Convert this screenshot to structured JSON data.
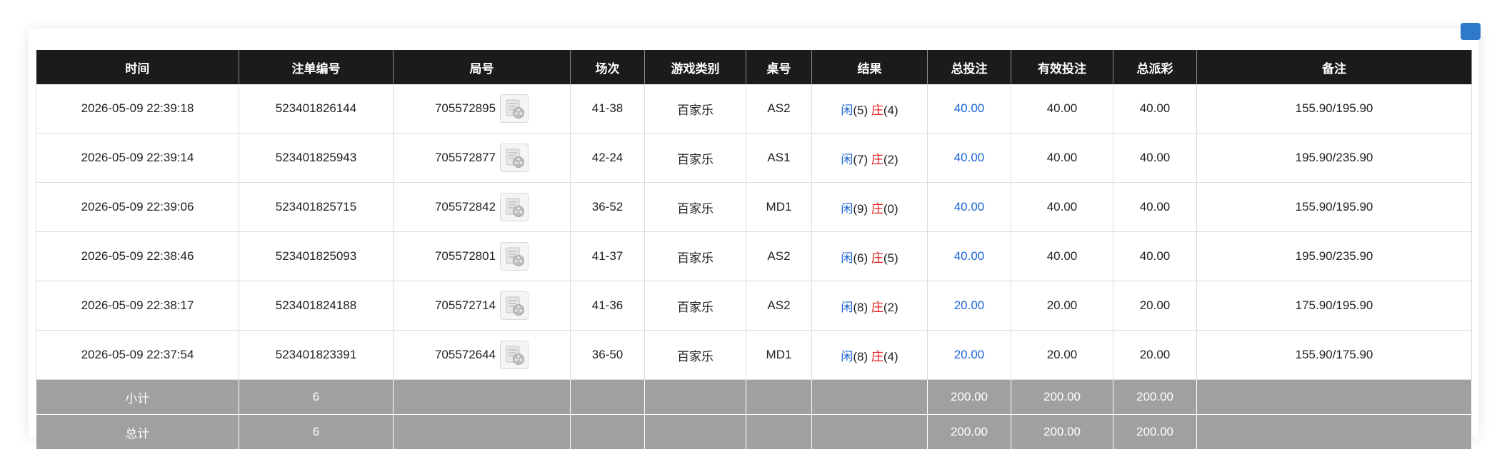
{
  "colors": {
    "header_bg": "#1b1b1b",
    "summary_bg": "#a0a0a0",
    "player_blue": "#1a64d6",
    "banker_red": "#e01b1b",
    "corner_button": "#2f79c9"
  },
  "table": {
    "headers": [
      "时间",
      "注单编号",
      "局号",
      "场次",
      "游戏类别",
      "桌号",
      "结果",
      "总投注",
      "有效投注",
      "总派彩",
      "备注"
    ],
    "rows": [
      {
        "time": "2026-05-09 22:39:18",
        "order": "523401826144",
        "round": "705572895",
        "session": "41-38",
        "game": "百家乐",
        "table": "AS2",
        "player": "闲",
        "player_score": "(5)",
        "banker": "庄",
        "banker_score": "(4)",
        "total_bet": "40.00",
        "valid_bet": "40.00",
        "payout": "40.00",
        "remark": "155.90/195.90"
      },
      {
        "time": "2026-05-09 22:39:14",
        "order": "523401825943",
        "round": "705572877",
        "session": "42-24",
        "game": "百家乐",
        "table": "AS1",
        "player": "闲",
        "player_score": "(7)",
        "banker": "庄",
        "banker_score": "(2)",
        "total_bet": "40.00",
        "valid_bet": "40.00",
        "payout": "40.00",
        "remark": "195.90/235.90"
      },
      {
        "time": "2026-05-09 22:39:06",
        "order": "523401825715",
        "round": "705572842",
        "session": "36-52",
        "game": "百家乐",
        "table": "MD1",
        "player": "闲",
        "player_score": "(9)",
        "banker": "庄",
        "banker_score": "(0)",
        "total_bet": "40.00",
        "valid_bet": "40.00",
        "payout": "40.00",
        "remark": "155.90/195.90"
      },
      {
        "time": "2026-05-09 22:38:46",
        "order": "523401825093",
        "round": "705572801",
        "session": "41-37",
        "game": "百家乐",
        "table": "AS2",
        "player": "闲",
        "player_score": "(6)",
        "banker": "庄",
        "banker_score": "(5)",
        "total_bet": "40.00",
        "valid_bet": "40.00",
        "payout": "40.00",
        "remark": "195.90/235.90"
      },
      {
        "time": "2026-05-09 22:38:17",
        "order": "523401824188",
        "round": "705572714",
        "session": "41-36",
        "game": "百家乐",
        "table": "AS2",
        "player": "闲",
        "player_score": "(8)",
        "banker": "庄",
        "banker_score": "(2)",
        "total_bet": "20.00",
        "valid_bet": "20.00",
        "payout": "20.00",
        "remark": "175.90/195.90"
      },
      {
        "time": "2026-05-09 22:37:54",
        "order": "523401823391",
        "round": "705572644",
        "session": "36-50",
        "game": "百家乐",
        "table": "MD1",
        "player": "闲",
        "player_score": "(8)",
        "banker": "庄",
        "banker_score": "(4)",
        "total_bet": "20.00",
        "valid_bet": "20.00",
        "payout": "20.00",
        "remark": "155.90/175.90"
      }
    ],
    "subtotal": {
      "label": "小计",
      "count": "6",
      "total_bet": "200.00",
      "valid_bet": "200.00",
      "payout": "200.00"
    },
    "grand_total": {
      "label": "总计",
      "count": "6",
      "total_bet": "200.00",
      "valid_bet": "200.00",
      "payout": "200.00"
    }
  },
  "icons": {
    "replay": "video-replay-icon",
    "corner": "corner-button"
  }
}
